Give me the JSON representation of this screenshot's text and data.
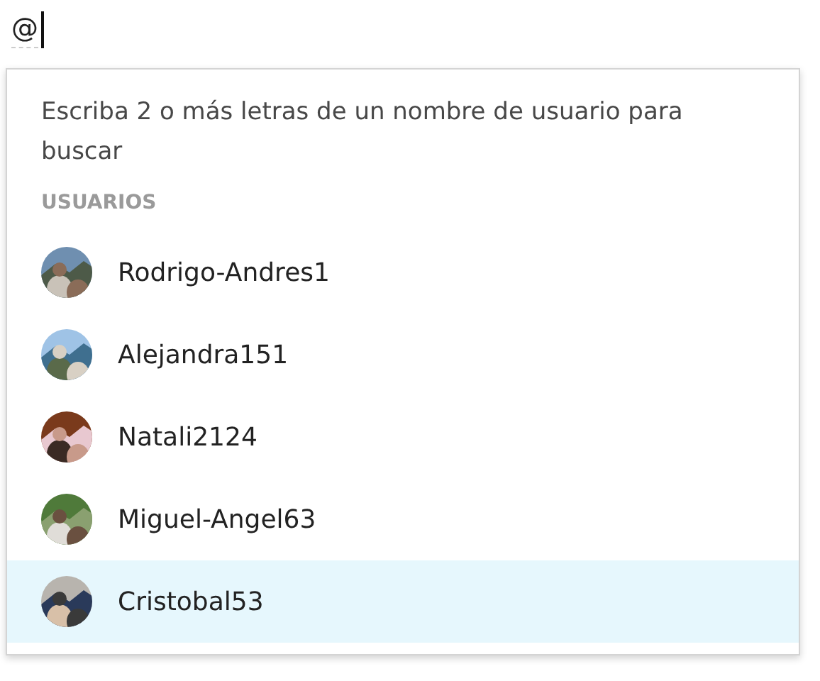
{
  "editor": {
    "value": "@"
  },
  "mention_popup": {
    "hint": "Escriba 2 o más letras de un nombre de usuario para buscar",
    "section_title": "USUARIOS",
    "users": [
      {
        "name": "Rodrigo-Andres1",
        "selected": false
      },
      {
        "name": "Alejandra151",
        "selected": false
      },
      {
        "name": "Natali2124",
        "selected": false
      },
      {
        "name": "Miguel-Angel63",
        "selected": false
      },
      {
        "name": "Cristobal53",
        "selected": true
      }
    ]
  }
}
